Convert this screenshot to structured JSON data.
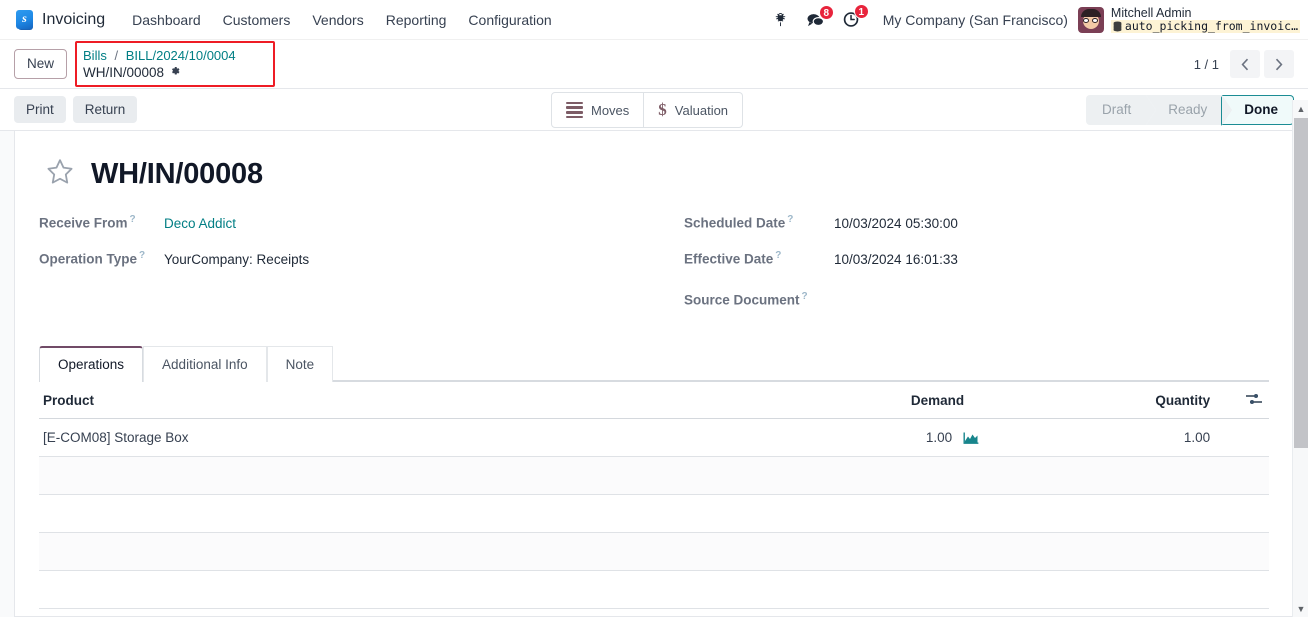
{
  "navbar": {
    "logo_icon": "odoo-logo-icon",
    "app_name": "Invoicing",
    "menus": [
      {
        "label": "Dashboard"
      },
      {
        "label": "Customers"
      },
      {
        "label": "Vendors"
      },
      {
        "label": "Reporting"
      },
      {
        "label": "Configuration"
      }
    ],
    "debug_icon": "bug-icon",
    "messages_icon": "messages-icon",
    "messages_count": "8",
    "activities_icon": "activities-clock-icon",
    "activities_count": "1",
    "company": "My Company (San Francisco)",
    "user_name": "Mitchell Admin",
    "database": "auto_picking_from_invoic…",
    "database_icon": "database-icon",
    "badge_color": "#e8243c",
    "db_highlight_color": "#fdf3d5"
  },
  "control_panel": {
    "new_label": "New",
    "breadcrumb": {
      "parent": "Bills",
      "separator": "/",
      "record": "BILL/2024/10/0004",
      "current": "WH/IN/00008",
      "gear_icon": "gear-icon",
      "highlight_color": "#ee1c25"
    },
    "stat_buttons": [
      {
        "label": "Moves",
        "icon": "bars-icon"
      },
      {
        "label": "Valuation",
        "icon": "dollar-icon"
      }
    ],
    "pager": {
      "text": "1 / 1",
      "prev_icon": "chevron-left-icon",
      "next_icon": "chevron-right-icon"
    }
  },
  "action_bar": {
    "buttons": [
      {
        "label": "Print"
      },
      {
        "label": "Return"
      }
    ],
    "statuses": [
      {
        "label": "Draft",
        "active": false
      },
      {
        "label": "Ready",
        "active": false
      },
      {
        "label": "Done",
        "active": true
      }
    ],
    "active_color": "#1b8c94"
  },
  "record": {
    "favorite_icon": "star-icon",
    "title": "WH/IN/00008",
    "left_fields": [
      {
        "label": "Receive From",
        "value": "Deco Addict",
        "is_link": true
      },
      {
        "label": "Operation Type",
        "value": "YourCompany: Receipts",
        "is_link": false
      }
    ],
    "right_fields": [
      {
        "label": "Scheduled Date",
        "value": "10/03/2024 05:30:00"
      },
      {
        "label": "Effective Date",
        "value": "10/03/2024 16:01:33"
      },
      {
        "label": "Source Document",
        "value": ""
      }
    ],
    "help_marker": "?"
  },
  "notebook": {
    "tabs": [
      {
        "label": "Operations",
        "active": true
      },
      {
        "label": "Additional Info",
        "active": false
      },
      {
        "label": "Note",
        "active": false
      }
    ]
  },
  "lines_table": {
    "columns": [
      {
        "label": "Product",
        "align": "left"
      },
      {
        "label": "Demand",
        "align": "right"
      },
      {
        "label": "Quantity",
        "align": "right"
      }
    ],
    "optional_columns_icon": "sliders-icon",
    "rows": [
      {
        "product": "[E-COM08] Storage Box",
        "demand": "1.00",
        "forecast_icon": "forecast-chart-icon",
        "quantity": "1.00"
      }
    ],
    "empty_row_count": 4
  },
  "scrollbar": {
    "up_icon": "scroll-up-icon",
    "down_icon": "scroll-down-icon"
  }
}
